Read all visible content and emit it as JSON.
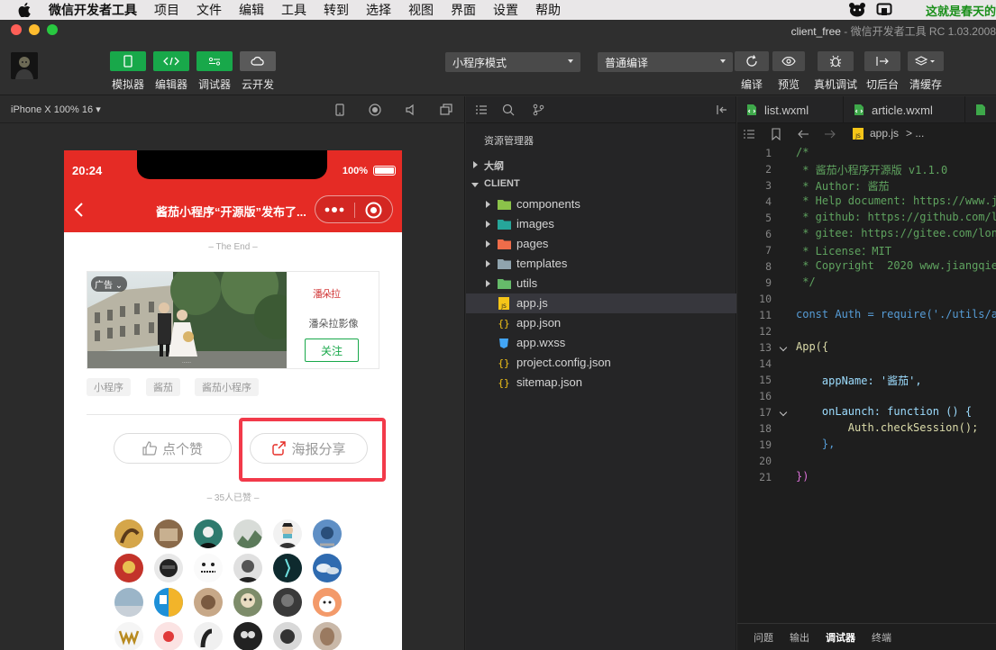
{
  "menubar": {
    "items": [
      "微信开发者工具",
      "项目",
      "文件",
      "编辑",
      "工具",
      "转到",
      "选择",
      "视图",
      "界面",
      "设置",
      "帮助"
    ],
    "right_text": "这就是春天的"
  },
  "window": {
    "title_prefix": "client_free",
    "title_rest": " - 微信开发者工具 RC 1.03.2008"
  },
  "toolbar": {
    "left_buttons": [
      {
        "label": "模拟器",
        "icon": "phone-icon",
        "active": true
      },
      {
        "label": "编辑器",
        "icon": "code-icon",
        "active": true
      },
      {
        "label": "调试器",
        "icon": "debug-icon",
        "active": true
      },
      {
        "label": "云开发",
        "icon": "cloud-icon",
        "active": false
      }
    ],
    "mode_select": "小程序模式",
    "compile_select": "普通编译",
    "right_buttons": [
      {
        "label": "编译",
        "icon": "refresh-icon"
      },
      {
        "label": "预览",
        "icon": "eye-icon"
      },
      {
        "label": "真机调试",
        "icon": "bug-icon"
      },
      {
        "label": "切后台",
        "icon": "background-icon"
      },
      {
        "label": "清缓存",
        "icon": "layers-icon"
      }
    ]
  },
  "simulator": {
    "device": "iPhone X 100% 16",
    "status_time": "20:24",
    "battery": "100%",
    "nav_title": "酱茄小程序“开源版”发布了...",
    "the_end": "– The End –",
    "ad": {
      "tag": "广告",
      "brand_logo": "潘朵拉",
      "brand_name": "潘朵拉影像",
      "follow": "关注"
    },
    "tags": [
      "小程序",
      "酱茄",
      "酱茄小程序"
    ],
    "like_button": "点个赞",
    "share_button": "海报分享",
    "likes_count": "– 35人已赞 –"
  },
  "explorer": {
    "title": "资源管理器",
    "outline": "大纲",
    "project": "CLIENT",
    "items": [
      {
        "name": "components",
        "type": "folder",
        "icon": "folder-components-icon",
        "color": "#8bc34a"
      },
      {
        "name": "images",
        "type": "folder",
        "icon": "folder-images-icon",
        "color": "#26a69a"
      },
      {
        "name": "pages",
        "type": "folder",
        "icon": "folder-pages-icon",
        "color": "#ef6c4a"
      },
      {
        "name": "templates",
        "type": "folder",
        "icon": "folder-icon",
        "color": "#90a4ae"
      },
      {
        "name": "utils",
        "type": "folder",
        "icon": "folder-utils-icon",
        "color": "#66bb6a"
      },
      {
        "name": "app.js",
        "type": "js",
        "icon": "js-file-icon",
        "color": "#f5c518"
      },
      {
        "name": "app.json",
        "type": "json",
        "icon": "json-file-icon",
        "color": "#f5c518"
      },
      {
        "name": "app.wxss",
        "type": "css",
        "icon": "css-file-icon",
        "color": "#42a5f5"
      },
      {
        "name": "project.config.json",
        "type": "json",
        "icon": "json-file-icon",
        "color": "#f5c518"
      },
      {
        "name": "sitemap.json",
        "type": "json",
        "icon": "json-file-icon",
        "color": "#f5c518"
      }
    ]
  },
  "editor": {
    "tabs": [
      "list.wxml",
      "article.wxml"
    ],
    "breadcrumb_file": "app.js",
    "breadcrumb_more": "> ...",
    "lines": [
      {
        "n": "1",
        "text": "/*"
      },
      {
        "n": "2",
        "text": " * 酱茄小程序开源版 v1.1.0"
      },
      {
        "n": "3",
        "text": " * Author: 酱茄"
      },
      {
        "n": "4",
        "text": " * Help document: https://www.j"
      },
      {
        "n": "5",
        "text": " * github: https://github.com/l"
      },
      {
        "n": "6",
        "text": " * gitee: https://gitee.com/lon"
      },
      {
        "n": "7",
        "text": " * License：MIT"
      },
      {
        "n": "8",
        "text": " * Copyright  2020 www.jiangqie"
      },
      {
        "n": "9",
        "text": " */"
      },
      {
        "n": "10",
        "text": ""
      },
      {
        "n": "11",
        "text": "const Auth = require('./utils/a"
      },
      {
        "n": "12",
        "text": ""
      },
      {
        "n": "13",
        "text": "App({"
      },
      {
        "n": "14",
        "text": ""
      },
      {
        "n": "15",
        "text": "    appName: '酱茄',"
      },
      {
        "n": "16",
        "text": ""
      },
      {
        "n": "17",
        "text": "    onLaunch: function () {"
      },
      {
        "n": "18",
        "text": "        Auth.checkSession();"
      },
      {
        "n": "19",
        "text": "    },"
      },
      {
        "n": "20",
        "text": ""
      },
      {
        "n": "21",
        "text": "})"
      }
    ],
    "bottom_tabs": [
      "问题",
      "输出",
      "调试器",
      "终端"
    ],
    "bottom_active": "调试器"
  },
  "colors": {
    "accent_green": "#18a84a",
    "nav_red": "#e52b25",
    "highlight_red": "#f23a4a"
  }
}
